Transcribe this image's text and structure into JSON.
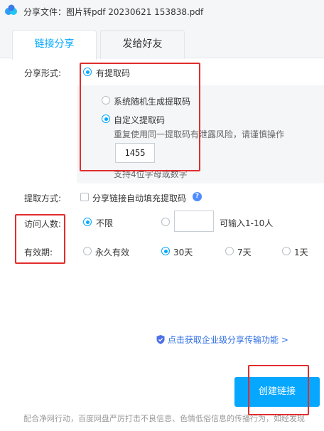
{
  "window": {
    "title": "分享文件：图片转pdf 20230621 153838.pdf"
  },
  "tabs": [
    {
      "label": "链接分享",
      "active": true
    },
    {
      "label": "发给好友",
      "active": false
    }
  ],
  "share_form": {
    "label": "分享形式:",
    "option_with_code": "有提取码",
    "code_options": {
      "random": "系统随机生成提取码",
      "custom": "自定义提取码",
      "selected": "custom"
    },
    "warning": "重复使用同一提取码有泄露风险，请谨慎操作",
    "code_value": "1455",
    "code_hint": "支持4位字母或数字"
  },
  "extract_method": {
    "label": "提取方式:",
    "autofill_label": "分享链接自动填充提取码",
    "autofill_checked": false,
    "help_icon_text": "?"
  },
  "visitors": {
    "label": "访问人数:",
    "unlimited": "不限",
    "limited_hint": "可输入1-10人",
    "selected": "unlimited"
  },
  "validity": {
    "label": "有效期:",
    "options": [
      "永久有效",
      "30天",
      "7天",
      "1天"
    ],
    "selected": "30天"
  },
  "promo_link": "点击获取企业级分享传输功能 >",
  "create_button": "创建链接",
  "footer_note": "配合净网行动，百度网盘严厉打击不良信息、色情低俗信息的传播行为，如经发现",
  "colors": {
    "accent": "#06a7ff",
    "annotation": "#e12d2d",
    "link": "#2f6fe4"
  }
}
